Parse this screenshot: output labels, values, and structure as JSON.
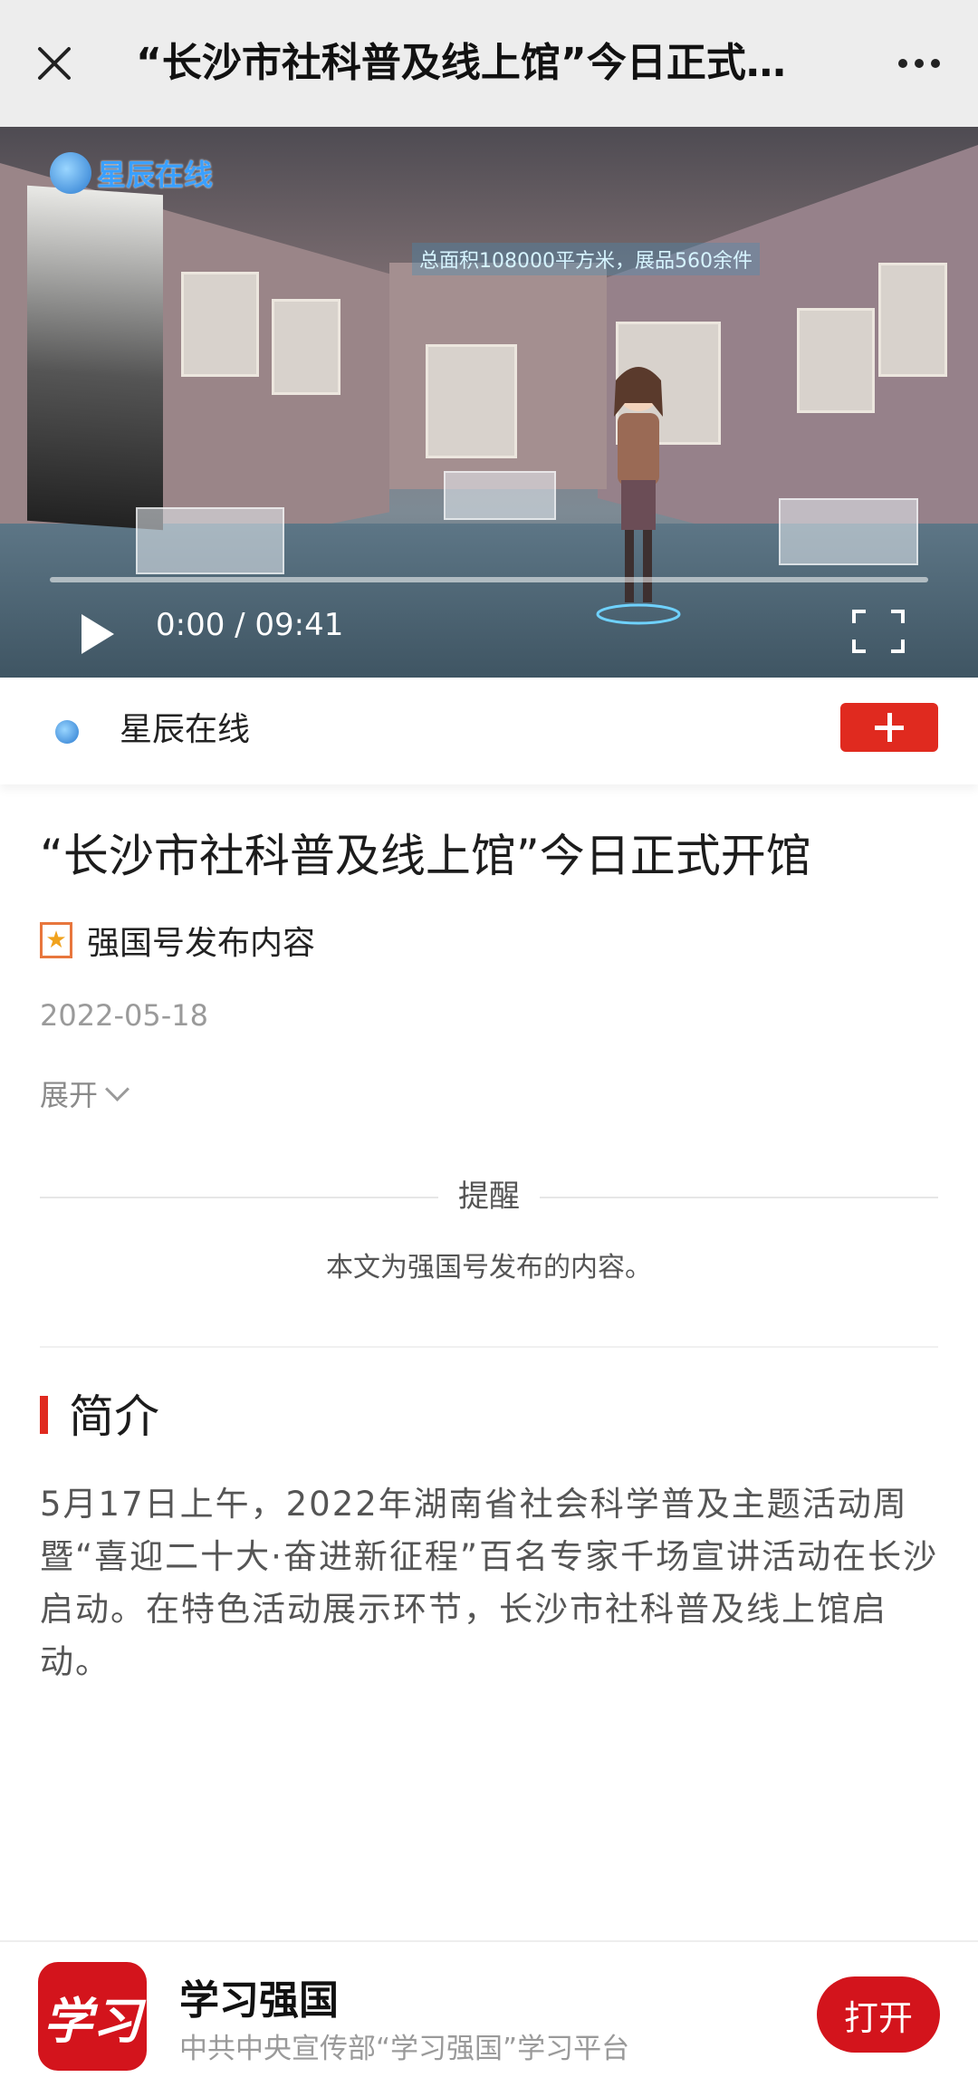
{
  "topbar": {
    "close_icon": "close-icon",
    "title": "“长沙市社科普及线上馆”今日正式…",
    "more_icon": "more-icon"
  },
  "video": {
    "logo_text": "星辰在线",
    "banner_text": "总面积108000平方米，展品560余件",
    "time": "0:00 / 09:41",
    "progress": 0,
    "play_icon": "play-icon",
    "fullscreen_icon": "fullscreen-icon"
  },
  "channel": {
    "name": "星辰在线",
    "follow_icon": "plus-icon",
    "accent": "#e02a1f"
  },
  "article": {
    "headline": "“长沙市社科普及线上馆”今日正式开馆",
    "source": "强国号发布内容",
    "date": "2022-05-18",
    "expand": "展开",
    "notice_title": "提醒",
    "notice_body": "本文为强国号发布的内容。",
    "section_title": "简介",
    "intro": "5月17日上午，2022年湖南省社会科学普及主题活动周暨“喜迎二十大·奋进新征程”百名专家千场宣讲活动在长沙启动。在特色活动展示环节，长沙市社科普及线上馆启动。"
  },
  "bottombar": {
    "app_icon_text": "学习",
    "app_name": "学习强国",
    "app_desc": "中共中央宣传部“学习强国”学习平台",
    "open_label": "打开",
    "brand_color": "#d3141c"
  }
}
